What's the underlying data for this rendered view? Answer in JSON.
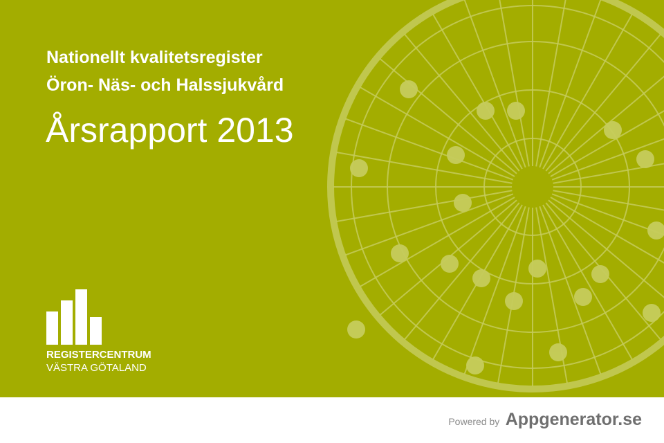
{
  "cover": {
    "subtitle_line1": "Nationellt kvalitetsregister",
    "subtitle_line2": "Öron- Näs- och Halssjukvård",
    "title": "Årsrapport 2013",
    "background_color": "#a3ad00",
    "logo": {
      "line1": "REGISTERCENTRUM",
      "line2": "VÄSTRA GÖTALAND"
    }
  },
  "footer": {
    "powered_by": "Powered by",
    "brand": "Appgenerator.se"
  }
}
